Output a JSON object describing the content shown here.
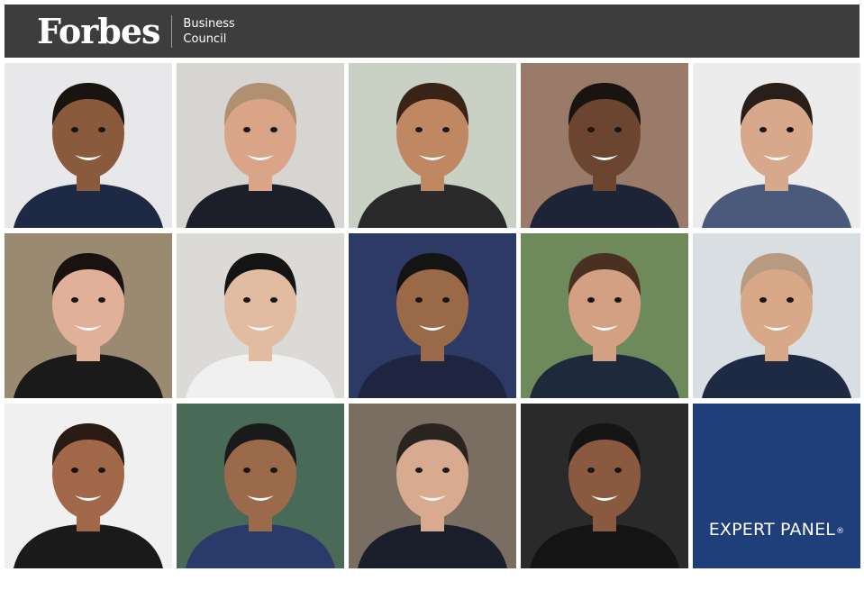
{
  "header": {
    "logo_text": "Forbes",
    "council_line1": "Business",
    "council_line2": "Council"
  },
  "panel": {
    "label": "EXPERT PANEL",
    "mark": "®",
    "color": "#1f3f7a"
  },
  "portraits": [
    {
      "bg": "#e8e8ea",
      "skin": "#8a5a3c",
      "hair": "#1a1410",
      "shirt": "#1e2a44"
    },
    {
      "bg": "#d7d5d2",
      "skin": "#d9a488",
      "hair": "#b09070",
      "shirt": "#1c1f2a"
    },
    {
      "bg": "#c9d1c4",
      "skin": "#c08862",
      "hair": "#3a2418",
      "shirt": "#2a2a2a"
    },
    {
      "bg": "#9a7a68",
      "skin": "#6b4530",
      "hair": "#1a1410",
      "shirt": "#1c2436"
    },
    {
      "bg": "#ececec",
      "skin": "#d8a88c",
      "hair": "#2a1e18",
      "shirt": "#4a5a7a"
    },
    {
      "bg": "#9a8a72",
      "skin": "#e0b098",
      "hair": "#1a1210",
      "shirt": "#1a1a1a"
    },
    {
      "bg": "#dcdad6",
      "skin": "#e2bca0",
      "hair": "#141414",
      "shirt": "#f0f0f0"
    },
    {
      "bg": "#2e3a66",
      "skin": "#9a6a48",
      "hair": "#141414",
      "shirt": "#1e2540"
    },
    {
      "bg": "#6f8a5a",
      "skin": "#d4a084",
      "hair": "#4a3020",
      "shirt": "#1e2a3c"
    },
    {
      "bg": "#d8dee2",
      "skin": "#d8a888",
      "hair": "#b89a80",
      "shirt": "#1e2a44"
    },
    {
      "bg": "#f0f0f0",
      "skin": "#a06848",
      "hair": "#2a1a14",
      "shirt": "#1a1a1a"
    },
    {
      "bg": "#4a6a58",
      "skin": "#9a6a4a",
      "hair": "#1a1a1a",
      "shirt": "#2a3a6a"
    },
    {
      "bg": "#7a6e62",
      "skin": "#d8aa90",
      "hair": "#2a2420",
      "shirt": "#1a1e2a"
    },
    {
      "bg": "#2a2a2a",
      "skin": "#8a5a40",
      "hair": "#141414",
      "shirt": "#141414"
    }
  ]
}
